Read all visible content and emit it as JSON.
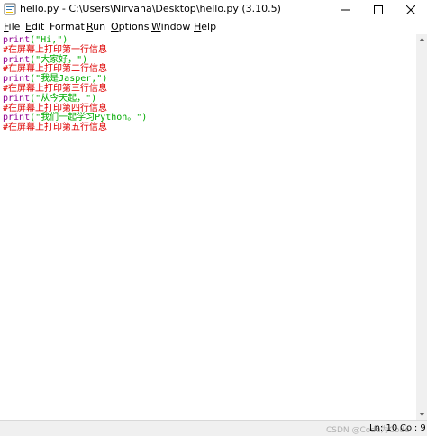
{
  "window": {
    "title": "hello.py - C:\\Users\\Nirvana\\Desktop\\hello.py (3.10.5)"
  },
  "menu": {
    "file": {
      "first": "F",
      "rest": "ile"
    },
    "edit": {
      "first": "E",
      "rest": "dit"
    },
    "format": {
      "first": "Format",
      "rest": ""
    },
    "run": {
      "first": "R",
      "rest": "un"
    },
    "options": {
      "first": "O",
      "rest": "ptions"
    },
    "window": {
      "first": "W",
      "rest": "indow"
    },
    "help": {
      "first": "H",
      "rest": "elp"
    }
  },
  "editor": {
    "lines": [
      {
        "kw": "print",
        "rest": "(\"Hi,\")"
      },
      {
        "comment": "#在屏幕上打印第一行信息"
      },
      {
        "kw": "print",
        "rest": "(\"大家好，\")"
      },
      {
        "comment": "#在屏幕上打印第二行信息"
      },
      {
        "kw": "print",
        "rest": "(\"我是Jasper,\")"
      },
      {
        "comment": "#在屏幕上打印第三行信息"
      },
      {
        "kw": "print",
        "rest": "(\"从今天起，\")"
      },
      {
        "comment": "#在屏幕上打印第四行信息"
      },
      {
        "kw": "print",
        "rest": "(\"我们一起学习Python。\")"
      },
      {
        "comment": "#在屏幕上打印第五行信息"
      }
    ]
  },
  "status": {
    "line": "Ln: 10",
    "col": "Col: 9",
    "watermark": "CSDN @Code为Code"
  },
  "colors": {
    "keyword": "#900090",
    "string": "#00aa00",
    "comment": "#dd0000"
  }
}
